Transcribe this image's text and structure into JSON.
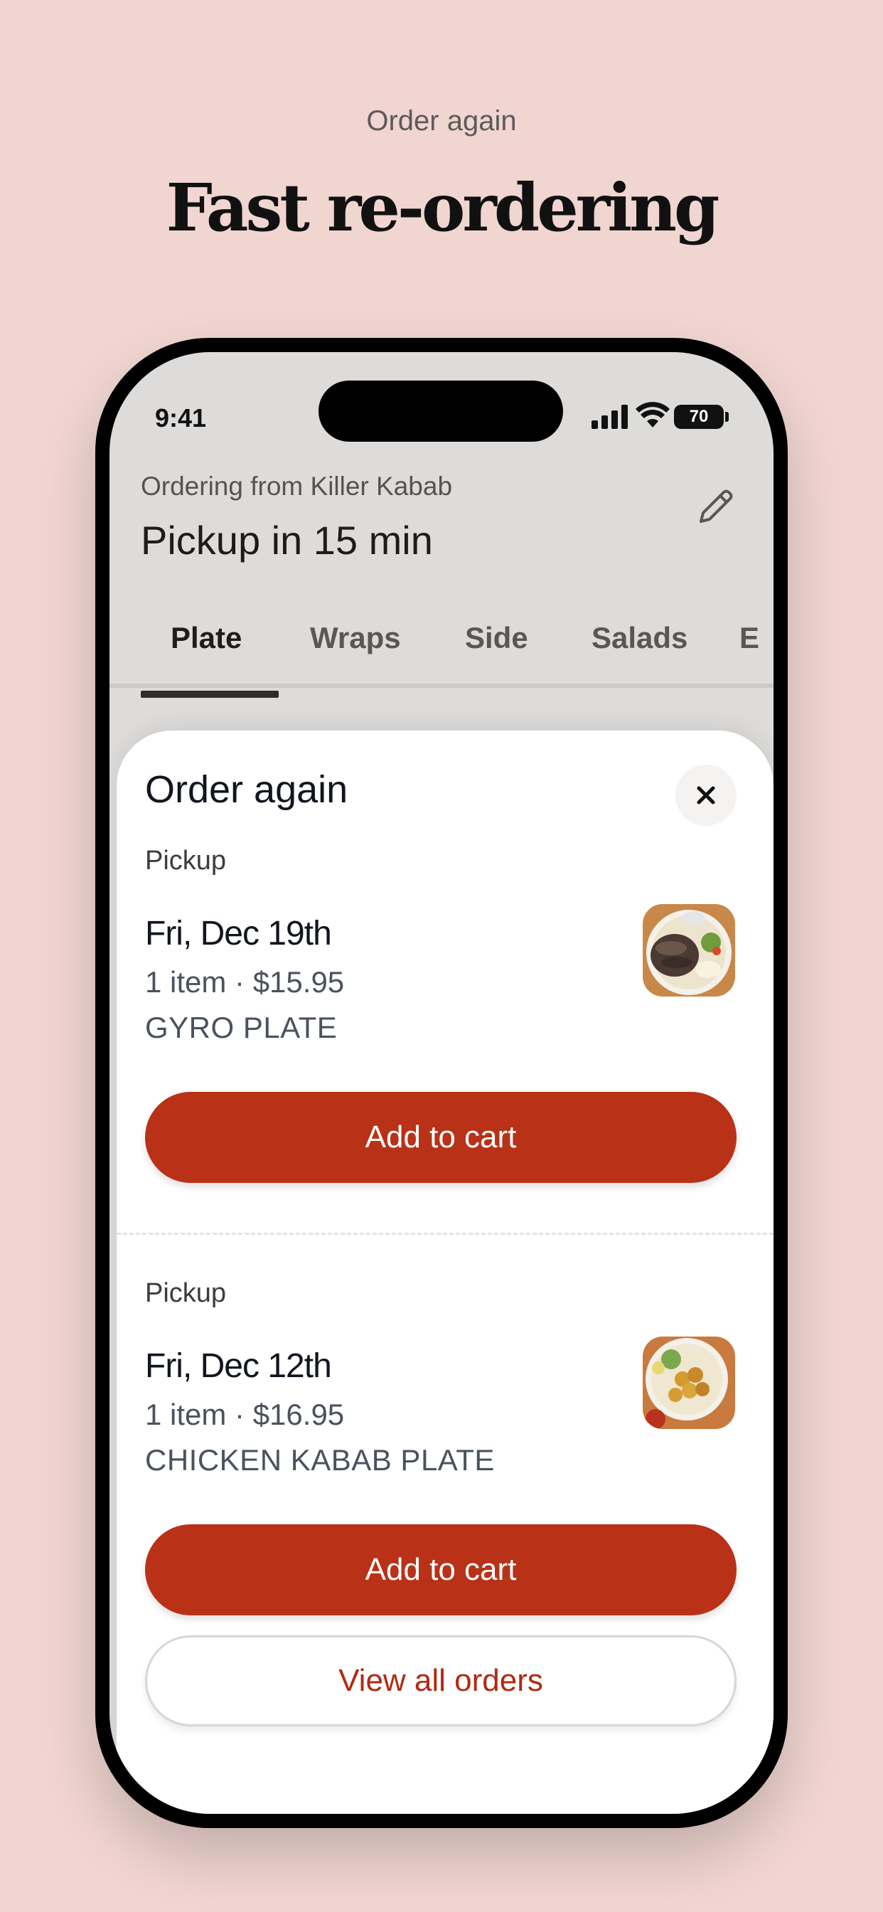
{
  "header": {
    "eyebrow": "Order again",
    "headline": "Fast re-ordering"
  },
  "status_bar": {
    "time": "9:41",
    "battery": "70"
  },
  "app": {
    "ordering_from": "Ordering from Killer Kabab",
    "pickup_title": "Pickup in 15 min",
    "tabs": [
      {
        "label": "Plate",
        "active": true
      },
      {
        "label": "Wraps",
        "active": false
      },
      {
        "label": "Side",
        "active": false
      },
      {
        "label": "Salads",
        "active": false
      },
      {
        "label": "E",
        "active": false
      }
    ]
  },
  "sheet": {
    "title": "Order again",
    "orders": [
      {
        "type": "Pickup",
        "date": "Fri, Dec 19th",
        "meta": "1 item · $15.95",
        "name": "GYRO PLATE",
        "button": "Add to cart",
        "thumb_icon": "gyro-plate-photo"
      },
      {
        "type": "Pickup",
        "date": "Fri, Dec 12th",
        "meta": "1 item · $16.95",
        "name": "CHICKEN KABAB PLATE",
        "button": "Add to cart",
        "thumb_icon": "chicken-kabab-plate-photo"
      }
    ],
    "view_all": "View all orders"
  },
  "colors": {
    "background": "#f0d5d0",
    "accent": "#b93117",
    "link": "#b02a10"
  }
}
